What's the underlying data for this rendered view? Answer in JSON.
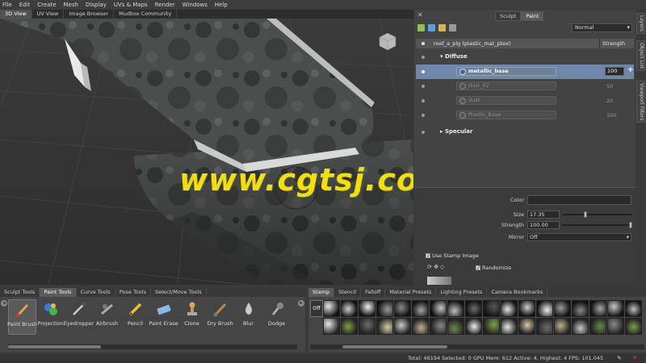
{
  "menu": [
    "File",
    "Edit",
    "Create",
    "Mesh",
    "Display",
    "UVs & Maps",
    "Render",
    "Windows",
    "Help"
  ],
  "viewport_tabs": [
    "3D View",
    "UV View",
    "Image Browser",
    "Mudbox Community"
  ],
  "watermark": "www.cgtsj.com",
  "right_panel": {
    "tabs": [
      "Sculpt",
      "Paint"
    ],
    "blend_mode": "Normal",
    "layer_name": "roof_a_plg (plastic_mat_ptex)",
    "strength_header": "Strength",
    "groups": [
      "Diffuse",
      "Specular"
    ],
    "channels": [
      {
        "name": "metallic_base",
        "value": "100"
      },
      {
        "name": "dust_02",
        "value": "50"
      },
      {
        "name": "dust",
        "value": "20"
      },
      {
        "name": "Plastic_Base",
        "value": "100"
      }
    ],
    "side_tabs": [
      "Layers",
      "Object List",
      "Viewport Filters"
    ]
  },
  "properties": {
    "color_label": "Color",
    "size_label": "Size",
    "size_value": "17.35",
    "size_level": 0.32,
    "strength_label": "Strength",
    "strength_value": "100.00",
    "strength_level": 1.0,
    "mirror_label": "Mirror",
    "mirror_value": "Off",
    "use_stamp_label": "Use Stamp Image",
    "randomize_label": "Randomize"
  },
  "shelf": {
    "tabs": [
      "Sculpt Tools",
      "Paint Tools",
      "Curve Tools",
      "Pose Tools",
      "Select/Move Tools"
    ],
    "tools": [
      "Paint Brush",
      "Projection",
      "Eyedropper",
      "Airbrush",
      "Pencil",
      "Paint Erase",
      "Clone",
      "Dry Brush",
      "Blur",
      "Dodge"
    ]
  },
  "stamp": {
    "tabs": [
      "Stamp",
      "Stencil",
      "Falloff",
      "Material Presets",
      "Lighting Presets",
      "Camera Bookmarks"
    ],
    "off_label": "Off"
  },
  "status": "Total: 46194  Selected: 0 GPU Mem: 612  Active: 4, Highest: 4  FPS: 101.045"
}
